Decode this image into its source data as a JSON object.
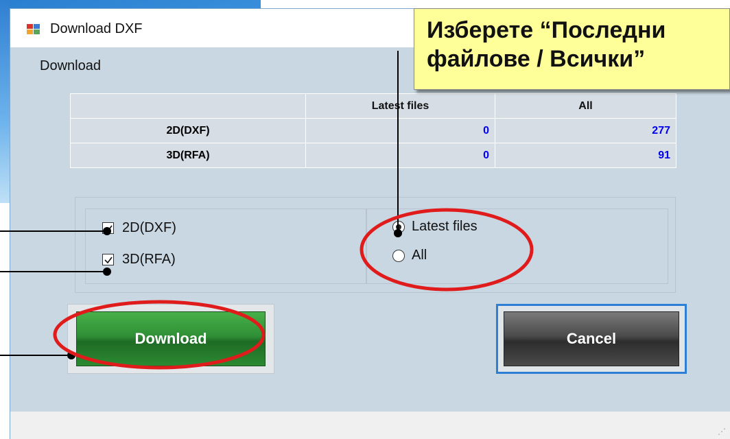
{
  "window": {
    "title": "Download DXF"
  },
  "group": {
    "label": "Download"
  },
  "table": {
    "headers": [
      "",
      "Latest files",
      "All"
    ],
    "rows": [
      {
        "name": "2D(DXF)",
        "latest": "0",
        "all": "277"
      },
      {
        "name": "3D(RFA)",
        "latest": "0",
        "all": "91"
      }
    ]
  },
  "checkboxes": [
    {
      "label": "2D(DXF)",
      "checked": true
    },
    {
      "label": "3D(RFA)",
      "checked": true
    }
  ],
  "radios": [
    {
      "label": "Latest files",
      "selected": true
    },
    {
      "label": "All",
      "selected": false
    }
  ],
  "buttons": {
    "download": "Download",
    "cancel": "Cancel"
  },
  "callout": {
    "line1": "Изберете “Последни",
    "line2": "файлове / Всички”"
  },
  "colors": {
    "annotation_circle": "#e01b1b",
    "callout_fill": "#ffff99",
    "download_button": "#2f8f35",
    "cancel_button": "#4a4a4a",
    "value_text": "#0000ee"
  }
}
